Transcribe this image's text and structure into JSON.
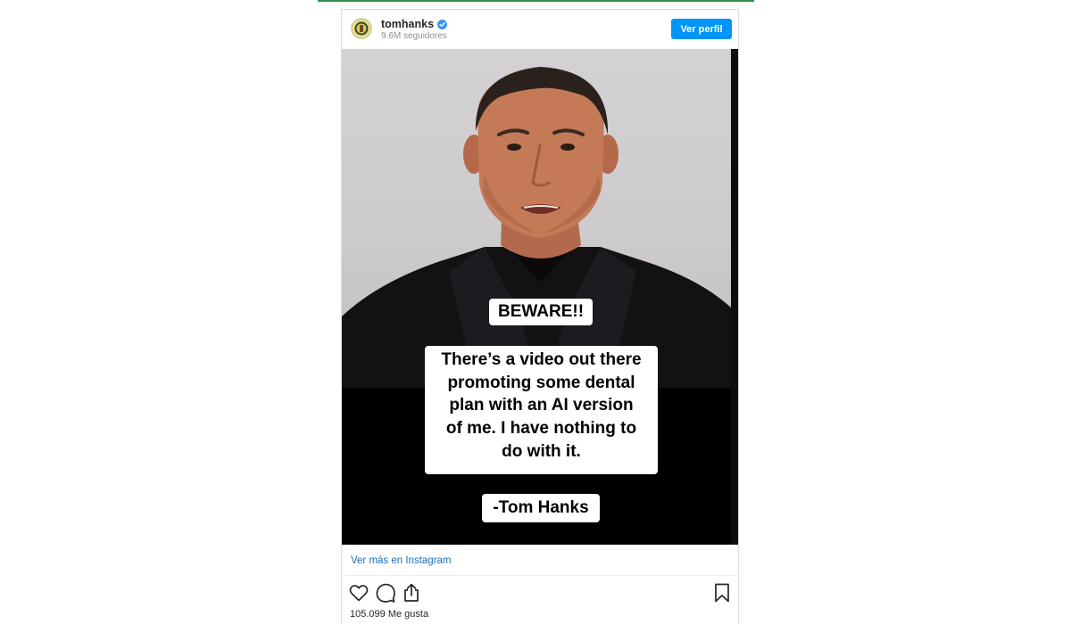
{
  "colors": {
    "accent_line": "#3a8f4a",
    "button_blue": "#0095f6",
    "link_blue": "#1e6fb8"
  },
  "header": {
    "username": "tomhanks",
    "verified_icon": "verified-badge-icon",
    "followers": "9.6M seguidores",
    "button_label": "Ver perfil"
  },
  "post": {
    "panel_beware": "BEWARE!!",
    "panel_message": "There’s a video out there\npromoting some dental\nplan with an AI version\nof me.  I have nothing to\ndo with it.",
    "panel_signature": "-Tom Hanks"
  },
  "footer": {
    "view_more": "Ver más en Instagram",
    "likes": "105.099 Me gusta",
    "icons": [
      "heart-icon",
      "comment-icon",
      "share-icon",
      "bookmark-icon"
    ]
  }
}
